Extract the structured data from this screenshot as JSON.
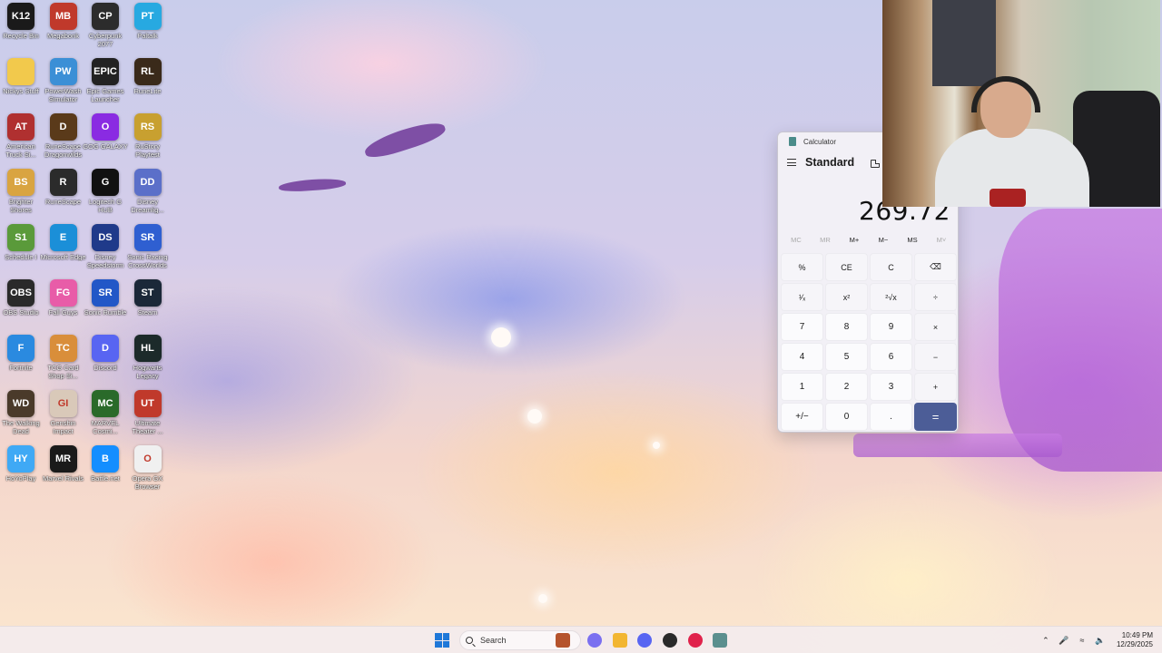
{
  "desktop": {
    "icons": [
      {
        "label": "Recycle Bin",
        "tile": "K12",
        "color": "#1a1a1a"
      },
      {
        "label": "Megabonk",
        "tile": "MB",
        "color": "#c0392b"
      },
      {
        "label": "Cyberpunk 2077",
        "tile": "CP",
        "color": "#2c2c2c"
      },
      {
        "label": "Paltalk",
        "tile": "PT",
        "color": "#27a9e1"
      },
      {
        "label": "Nickys Stuff",
        "tile": "",
        "color": "#f2c94c"
      },
      {
        "label": "PowerWash Simulator",
        "tile": "PW",
        "color": "#3b8fd6"
      },
      {
        "label": "Epic Games Launcher",
        "tile": "EPIC",
        "color": "#222222"
      },
      {
        "label": "RuneLite",
        "tile": "RL",
        "color": "#3a2a1a"
      },
      {
        "label": "American Truck Si...",
        "tile": "AT",
        "color": "#b03030"
      },
      {
        "label": "RuneScape Dragonwilds",
        "tile": "D",
        "color": "#5a3a1a"
      },
      {
        "label": "GOG GALAXY",
        "tile": "O",
        "color": "#8a2be2"
      },
      {
        "label": "RuStory Playtest",
        "tile": "RS",
        "color": "#c8a030"
      },
      {
        "label": "Brighter Shores",
        "tile": "BS",
        "color": "#d9a441"
      },
      {
        "label": "RuneScape",
        "tile": "R",
        "color": "#2b2b2b"
      },
      {
        "label": "Logitech G HUB",
        "tile": "G",
        "color": "#111111"
      },
      {
        "label": "Disney Dreamlig...",
        "tile": "DD",
        "color": "#5b6fc9"
      },
      {
        "label": "Schedule I",
        "tile": "S1",
        "color": "#5a9a3a"
      },
      {
        "label": "Microsoft Edge",
        "tile": "E",
        "color": "#1b8fd8"
      },
      {
        "label": "Disney Speedstorm",
        "tile": "DS",
        "color": "#1f3a8a"
      },
      {
        "label": "Sonic Racing CrossWorlds",
        "tile": "SR",
        "color": "#2f5fd1"
      },
      {
        "label": "OBS Studio",
        "tile": "OBS",
        "color": "#2a2a2a"
      },
      {
        "label": "Fall Guys",
        "tile": "FG",
        "color": "#e85ca8"
      },
      {
        "label": "Sonic Rumble",
        "tile": "SR",
        "color": "#2257c7"
      },
      {
        "label": "Steam",
        "tile": "ST",
        "color": "#1b2838"
      },
      {
        "label": "Fortnite",
        "tile": "F",
        "color": "#2a8ae0"
      },
      {
        "label": "TCG Card Shop Si...",
        "tile": "TC",
        "color": "#d98e3a"
      },
      {
        "label": "Discord",
        "tile": "D",
        "color": "#5865f2"
      },
      {
        "label": "Hogwarts Legacy",
        "tile": "HL",
        "color": "#1c2a2a"
      },
      {
        "label": "The Walking Dead",
        "tile": "WD",
        "color": "#4a3a2a"
      },
      {
        "label": "Genshin Impact",
        "tile": "GI",
        "color": "#d9c9b9"
      },
      {
        "label": "MARVEL Cosmi...",
        "tile": "MC",
        "color": "#2a6a2a"
      },
      {
        "label": "Ultimate Theater ...",
        "tile": "UT",
        "color": "#c0392b"
      },
      {
        "label": "HoYoPlay",
        "tile": "HY",
        "color": "#3fa9f5"
      },
      {
        "label": "Marvel Rivals",
        "tile": "MR",
        "color": "#1a1a1a"
      },
      {
        "label": "Battle.net",
        "tile": "B",
        "color": "#148eff"
      },
      {
        "label": "Opera GX Browser",
        "tile": "O",
        "color": "#f0f0f0"
      }
    ]
  },
  "calculator": {
    "window_title": "Calculator",
    "mode": "Standard",
    "display": "269.72",
    "memory": [
      {
        "label": "MC",
        "disabled": true
      },
      {
        "label": "MR",
        "disabled": true
      },
      {
        "label": "M+",
        "disabled": false
      },
      {
        "label": "M−",
        "disabled": false
      },
      {
        "label": "MS",
        "disabled": false
      },
      {
        "label": "M˅",
        "disabled": true
      }
    ],
    "keys": [
      {
        "label": "%",
        "type": "fn",
        "name": "percent-key"
      },
      {
        "label": "CE",
        "type": "fn",
        "name": "clear-entry-key"
      },
      {
        "label": "C",
        "type": "fn",
        "name": "clear-key"
      },
      {
        "label": "⌫",
        "type": "fn",
        "name": "backspace-key"
      },
      {
        "label": "¹⁄ₓ",
        "type": "fn",
        "name": "reciprocal-key"
      },
      {
        "label": "x²",
        "type": "fn",
        "name": "square-key"
      },
      {
        "label": "²√x",
        "type": "fn",
        "name": "square-root-key"
      },
      {
        "label": "÷",
        "type": "fn",
        "name": "divide-key"
      },
      {
        "label": "7",
        "type": "num",
        "name": "digit-7-key"
      },
      {
        "label": "8",
        "type": "num",
        "name": "digit-8-key"
      },
      {
        "label": "9",
        "type": "num",
        "name": "digit-9-key"
      },
      {
        "label": "×",
        "type": "fn",
        "name": "multiply-key"
      },
      {
        "label": "4",
        "type": "num",
        "name": "digit-4-key"
      },
      {
        "label": "5",
        "type": "num",
        "name": "digit-5-key"
      },
      {
        "label": "6",
        "type": "num",
        "name": "digit-6-key"
      },
      {
        "label": "−",
        "type": "fn",
        "name": "subtract-key"
      },
      {
        "label": "1",
        "type": "num",
        "name": "digit-1-key"
      },
      {
        "label": "2",
        "type": "num",
        "name": "digit-2-key"
      },
      {
        "label": "3",
        "type": "num",
        "name": "digit-3-key"
      },
      {
        "label": "+",
        "type": "fn",
        "name": "add-key"
      },
      {
        "label": "+/−",
        "type": "num",
        "name": "negate-key"
      },
      {
        "label": "0",
        "type": "num",
        "name": "digit-0-key"
      },
      {
        "label": ".",
        "type": "num",
        "name": "decimal-key"
      },
      {
        "label": "=",
        "type": "equals",
        "name": "equals-key"
      }
    ],
    "accent_color": "#4c5d97"
  },
  "taskbar": {
    "search_placeholder": "Search",
    "pinned_apps": [
      {
        "name": "guitar-app-icon",
        "color": "#b5532c"
      },
      {
        "name": "copilot-icon",
        "color": "#7a6ff0"
      },
      {
        "name": "file-explorer-icon",
        "color": "#f2b632"
      },
      {
        "name": "discord-taskbar-icon",
        "color": "#5865f2"
      },
      {
        "name": "obs-taskbar-icon",
        "color": "#2a2a2a"
      },
      {
        "name": "opera-gx-taskbar-icon",
        "color": "#e0224b"
      },
      {
        "name": "calculator-taskbar-icon",
        "color": "#5b8f8e"
      }
    ],
    "clock": {
      "time": "10:49 PM",
      "date": "12/29/2025"
    }
  }
}
